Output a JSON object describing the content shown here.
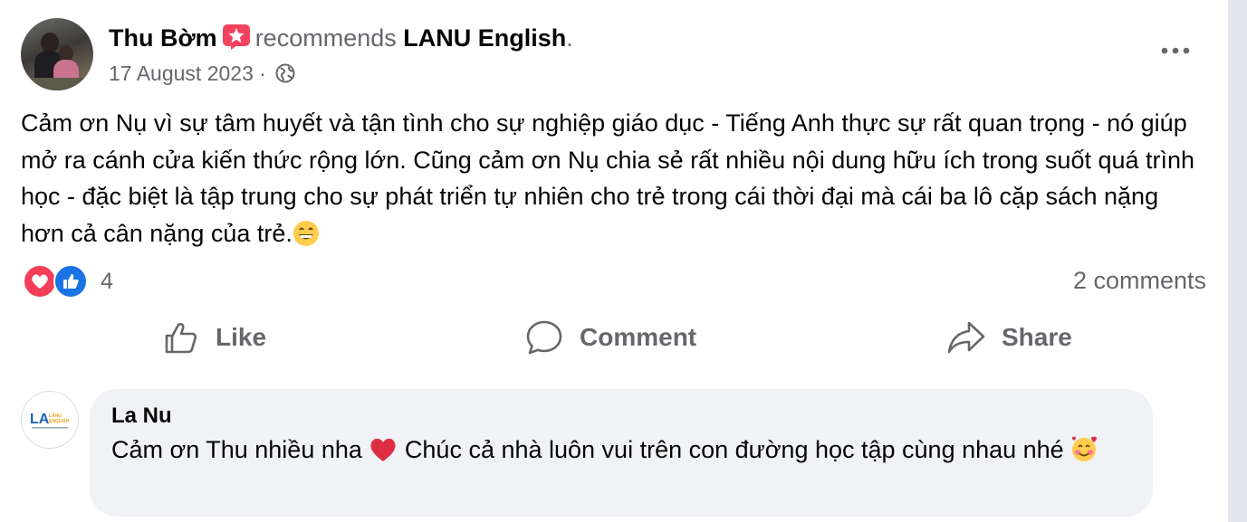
{
  "post": {
    "author": "Thu Bờm",
    "verb": "recommends",
    "page": "LANU English",
    "period": ".",
    "date": "17 August 2023",
    "separator": "·",
    "text": "Cảm ơn Nụ vì sự tâm huyết và tận tình cho sự nghiệp giáo dục - Tiếng Anh thực sự rất quan trọng - nó giúp mở ra cánh cửa kiến thức rộng lớn. Cũng cảm ơn Nụ chia sẻ rất nhiều nội dung hữu ích trong suốt quá trình học - đặc biệt là tập trung cho sự phát triển tự nhiên cho trẻ trong cái thời đại mà cái ba lô cặp sách nặng hơn cả cân nặng của trẻ."
  },
  "reactions": {
    "count": "4",
    "comments": "2 comments"
  },
  "actions": {
    "like": "Like",
    "comment": "Comment",
    "share": "Share"
  },
  "comment": {
    "author": "La Nu",
    "text_part1": "Cảm ơn Thu nhiều nha",
    "text_part2": " Chúc cả nhà luôn vui trên con đường học tập cùng nhau nhé",
    "logo_text": "LANU ENGLISH"
  },
  "colors": {
    "accent": "#1b74e4",
    "love": "#f33e58",
    "muted": "#65676b",
    "recommend_badge": "#f3425f"
  },
  "icons": [
    "recommend-badge-icon",
    "globe-icon",
    "more-options-icon",
    "love-reaction-icon",
    "like-reaction-icon",
    "like-icon",
    "comment-icon",
    "share-icon",
    "grin-emoji-icon",
    "red-heart-emoji-icon",
    "smiling-hearts-emoji-icon"
  ]
}
